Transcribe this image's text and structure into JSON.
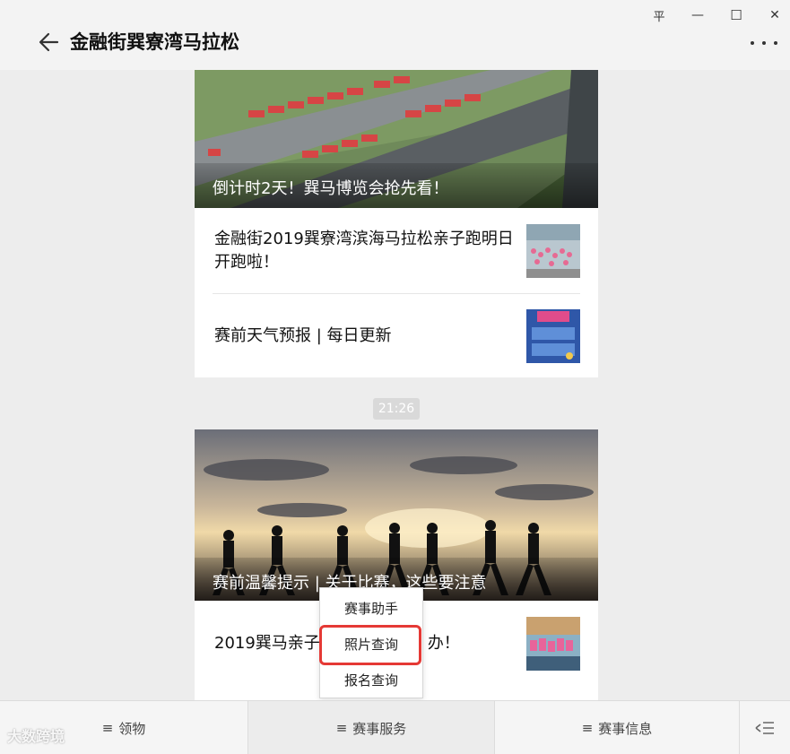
{
  "window": {
    "title": "金融街巽寮湾马拉松",
    "pin_glyph": "平",
    "minimize_glyph": "—",
    "maximize_glyph": "☐",
    "close_glyph": "✕"
  },
  "feed": {
    "card1": {
      "hero_caption": "倒计时2天！巽马博览会抢先看！",
      "articles": [
        {
          "title": "金融街2019巽寮湾滨海马拉松亲子跑明日开跑啦！"
        },
        {
          "title": "赛前天气预报 | 每日更新"
        }
      ]
    },
    "time": "21:26",
    "card2": {
      "hero_caption": "赛前温馨提示 | 关于比赛，这些要注意",
      "articles": [
        {
          "title_left": "2019巽马亲子",
          "title_right": "办！"
        }
      ]
    }
  },
  "popup_menu": {
    "items": [
      "赛事助手",
      "照片查询",
      "报名查询"
    ],
    "highlighted": "照片查询"
  },
  "bottom_menu": {
    "tabs": [
      "领物",
      "赛事服务",
      "赛事信息"
    ],
    "menu_glyph": "≡"
  },
  "watermark": "大数跨境",
  "colors": {
    "highlight": "#e53935",
    "background": "#ededed"
  }
}
